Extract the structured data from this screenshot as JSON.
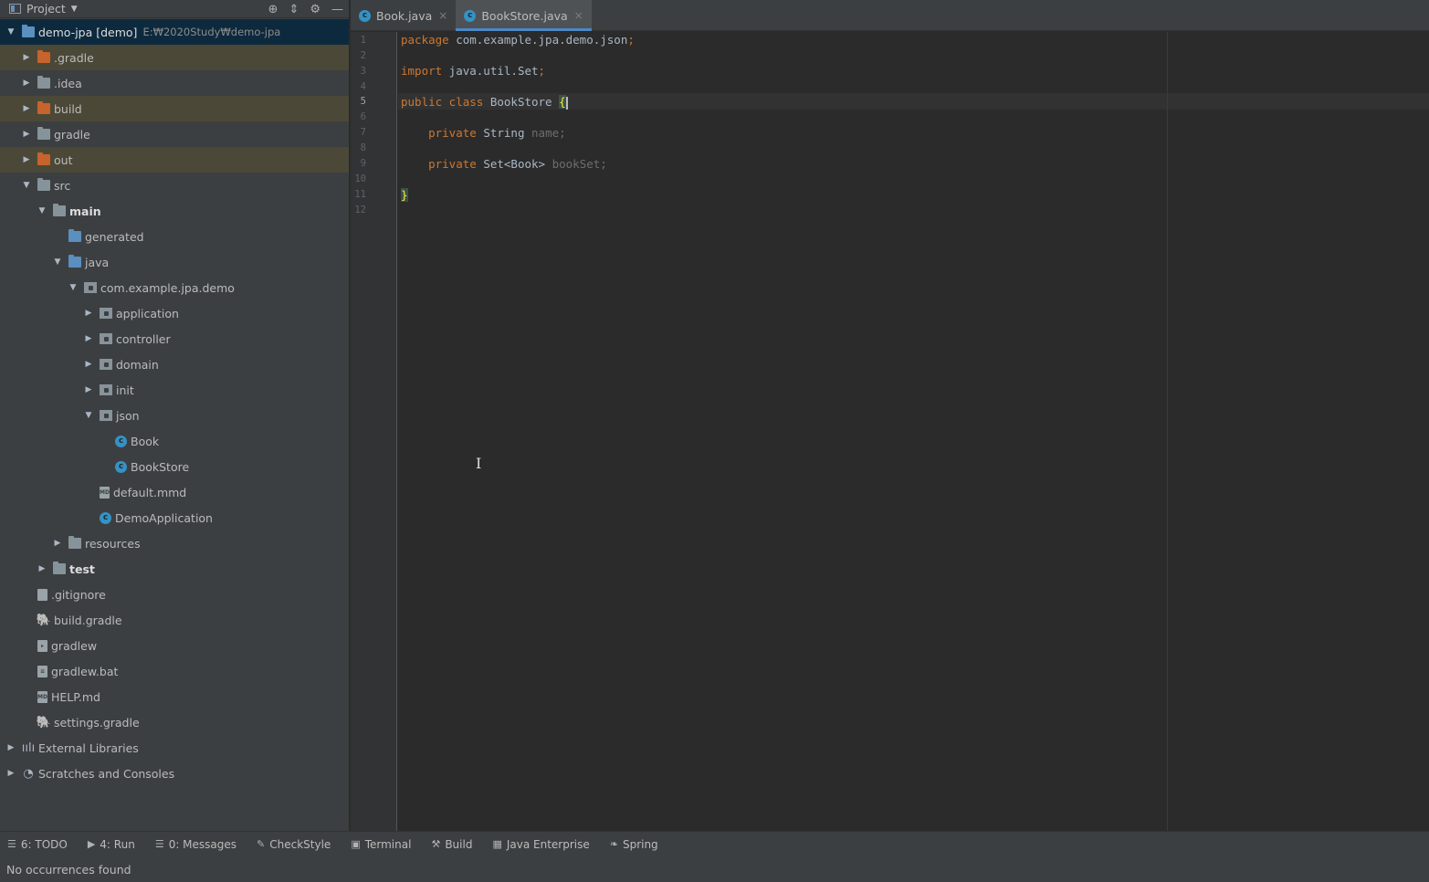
{
  "project_panel": {
    "title": "Project",
    "root_name": "demo-jpa [demo]",
    "root_path": "E:₩2020Study₩demo-jpa",
    "items": [
      {
        "label": ".gradle",
        "icon": "folder-icon"
      },
      {
        "label": ".idea",
        "icon": "folder-icon"
      },
      {
        "label": "build",
        "icon": "folder-icon"
      },
      {
        "label": "gradle",
        "icon": "folder-icon"
      },
      {
        "label": "out",
        "icon": "folder-icon"
      },
      {
        "label": "src",
        "icon": "folder-icon"
      },
      {
        "label": "main",
        "icon": "source-folder-icon"
      },
      {
        "label": "generated",
        "icon": "generated-folder-icon"
      },
      {
        "label": "java",
        "icon": "source-folder-icon"
      },
      {
        "label": "com.example.jpa.demo",
        "icon": "package-icon"
      },
      {
        "label": "application",
        "icon": "package-icon"
      },
      {
        "label": "controller",
        "icon": "package-icon"
      },
      {
        "label": "domain",
        "icon": "package-icon"
      },
      {
        "label": "init",
        "icon": "package-icon"
      },
      {
        "label": "json",
        "icon": "package-icon"
      },
      {
        "label": "Book",
        "icon": "class-icon"
      },
      {
        "label": "BookStore",
        "icon": "class-icon"
      },
      {
        "label": "default.mmd",
        "icon": "file-icon"
      },
      {
        "label": "DemoApplication",
        "icon": "spring-class-icon"
      },
      {
        "label": "resources",
        "icon": "resources-folder-icon"
      },
      {
        "label": "test",
        "icon": "test-folder-icon"
      },
      {
        "label": ".gitignore",
        "icon": "gitignore-icon"
      },
      {
        "label": "build.gradle",
        "icon": "gradle-icon"
      },
      {
        "label": "gradlew",
        "icon": "script-icon"
      },
      {
        "label": "gradlew.bat",
        "icon": "bat-file-icon"
      },
      {
        "label": "HELP.md",
        "icon": "markdown-icon"
      },
      {
        "label": "settings.gradle",
        "icon": "gradle-icon"
      },
      {
        "label": "External Libraries",
        "icon": "libraries-icon"
      },
      {
        "label": "Scratches and Consoles",
        "icon": "scratches-icon"
      }
    ]
  },
  "tabs": [
    {
      "label": "Book.java",
      "active": false
    },
    {
      "label": "BookStore.java",
      "active": true
    }
  ],
  "editor": {
    "line_numbers": [
      "1",
      "2",
      "3",
      "4",
      "5",
      "6",
      "7",
      "8",
      "9",
      "10",
      "11",
      "12"
    ],
    "current_line": "5",
    "code": {
      "l1_kw": "package",
      "l1_rest": " com.example.jpa.demo.json",
      "l3_kw": "import",
      "l3_rest": " java.util.Set",
      "l5_kw": "public class",
      "l5_rest": " BookStore ",
      "l5_brace": "{",
      "l7_kw": "private",
      "l7_type": " String ",
      "l7_field": "name",
      "l9_kw": "private",
      "l9_type": " Set<Book> ",
      "l9_field": "bookSet",
      "l11_brace": "}",
      "semicolon": ";"
    }
  },
  "tool_windows": [
    {
      "label": "6: TODO",
      "icon": "todo-icon"
    },
    {
      "label": "4: Run",
      "icon": "run-icon"
    },
    {
      "label": "0: Messages",
      "icon": "messages-icon"
    },
    {
      "label": "CheckStyle",
      "icon": "checkstyle-icon"
    },
    {
      "label": "Terminal",
      "icon": "terminal-icon"
    },
    {
      "label": "Build",
      "icon": "build-icon"
    },
    {
      "label": "Java Enterprise",
      "icon": "java-enterprise-icon"
    },
    {
      "label": "Spring",
      "icon": "spring-icon"
    }
  ],
  "status": {
    "message": "No occurrences found"
  },
  "colors": {
    "keyword": "#cc7832",
    "selection": "#0d293e",
    "excluded": "#4b4838",
    "accent": "#4a88c7"
  }
}
